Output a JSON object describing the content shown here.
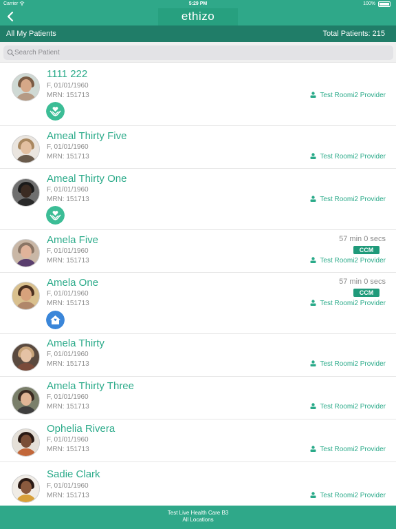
{
  "status": {
    "carrier": "Carrier",
    "time": "5:29 PM",
    "battery": "100%"
  },
  "header": {
    "logo": "ethizo",
    "list_title": "All My Patients",
    "total_label": "Total Patients: 215"
  },
  "search": {
    "placeholder": "Search Patient"
  },
  "patients": [
    {
      "name": "1111 222",
      "info": "F, 01/01/1960",
      "mrn": "MRN: 151713",
      "provider": "Test Roomi2 Provider"
    },
    {
      "name": "Ameal Thirty Five",
      "info": "F, 01/01/1960",
      "mrn": "MRN: 151713",
      "provider": "Test Roomi2 Provider"
    },
    {
      "name": "Ameal Thirty One",
      "info": "F, 01/01/1960",
      "mrn": "MRN: 151713",
      "provider": "Test Roomi2 Provider"
    },
    {
      "name": "Amela Five",
      "info": "F, 01/01/1960",
      "mrn": "MRN: 151713",
      "provider": "Test Roomi2 Provider",
      "timer": "57 min 0 secs",
      "badge": "CCM"
    },
    {
      "name": "Amela One",
      "info": "F, 01/01/1960",
      "mrn": "MRN: 151713",
      "provider": "Test Roomi2 Provider",
      "timer": "57 min 0 secs",
      "badge": "CCM"
    },
    {
      "name": "Amela Thirty",
      "info": "F, 01/01/1960",
      "mrn": "MRN: 151713",
      "provider": "Test Roomi2 Provider"
    },
    {
      "name": "Amela Thirty Three",
      "info": "F, 01/01/1960",
      "mrn": "MRN: 151713",
      "provider": "Test Roomi2 Provider"
    },
    {
      "name": "Ophelia Rivera",
      "info": "F, 01/01/1960",
      "mrn": "MRN: 151713",
      "provider": "Test Roomi2 Provider"
    },
    {
      "name": "Sadie Clark",
      "info": "F, 01/01/1960",
      "mrn": "MRN: 151713",
      "provider": "Test Roomi2 Provider"
    }
  ],
  "footer": {
    "line1": "Test Live Health Care B3",
    "line2": "All Locations"
  },
  "colors": {
    "brand": "#2fa889",
    "brand_dark": "#207d68",
    "accent_text": "#2aaa89"
  }
}
